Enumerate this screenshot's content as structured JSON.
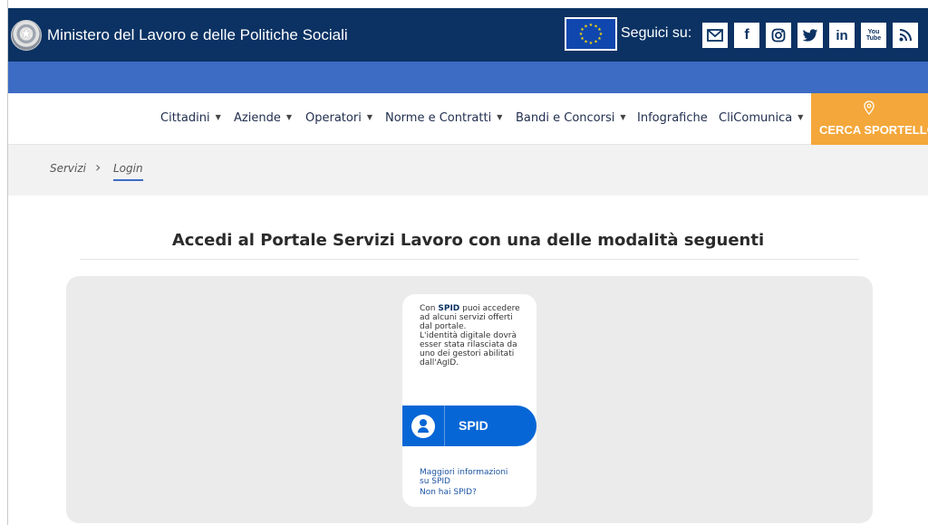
{
  "header": {
    "ministry_title": "Ministero del Lavoro e delle Politiche Sociali",
    "follow_label": "Seguici su:",
    "social_icons": [
      "email-icon",
      "facebook-icon",
      "instagram-icon",
      "twitter-icon",
      "linkedin-icon",
      "youtube-icon",
      "rss-icon"
    ],
    "social_glyphs": {
      "facebook": "f",
      "linkedin": "in",
      "youtube": "You Tube"
    },
    "colors": {
      "topbar": "#0b3263",
      "subbar": "#3d6cc4",
      "accent": "#f4a73a",
      "spid": "#0766d6"
    }
  },
  "nav": {
    "items": [
      {
        "label": "Cittadini",
        "dropdown": true
      },
      {
        "label": "Aziende",
        "dropdown": true
      },
      {
        "label": "Operatori",
        "dropdown": true
      },
      {
        "label": "Norme e Contratti",
        "dropdown": true
      },
      {
        "label": "Bandi e Concorsi",
        "dropdown": true
      },
      {
        "label": "Infografiche",
        "dropdown": false
      },
      {
        "label": "CliComunica",
        "dropdown": true
      }
    ],
    "cerca_label": "CERCA SPORTELLO"
  },
  "breadcrumb": {
    "items": [
      "Servizi",
      "Login"
    ]
  },
  "main": {
    "heading": "Accedi al Portale Servizi Lavoro con una delle modalità seguenti",
    "spid": {
      "desc_prefix": "Con",
      "desc_strong": "SPID",
      "desc_rest": "puoi accedere ad alcuni servizi offerti dal portale.",
      "desc_second": "L'identità digitale dovrà esser stata rilasciata da uno dei gestori abilitati dall'AgID.",
      "button_label": "SPID",
      "link_more": "Maggiori informazioni su SPID",
      "link_none": "Non hai SPID?"
    }
  }
}
